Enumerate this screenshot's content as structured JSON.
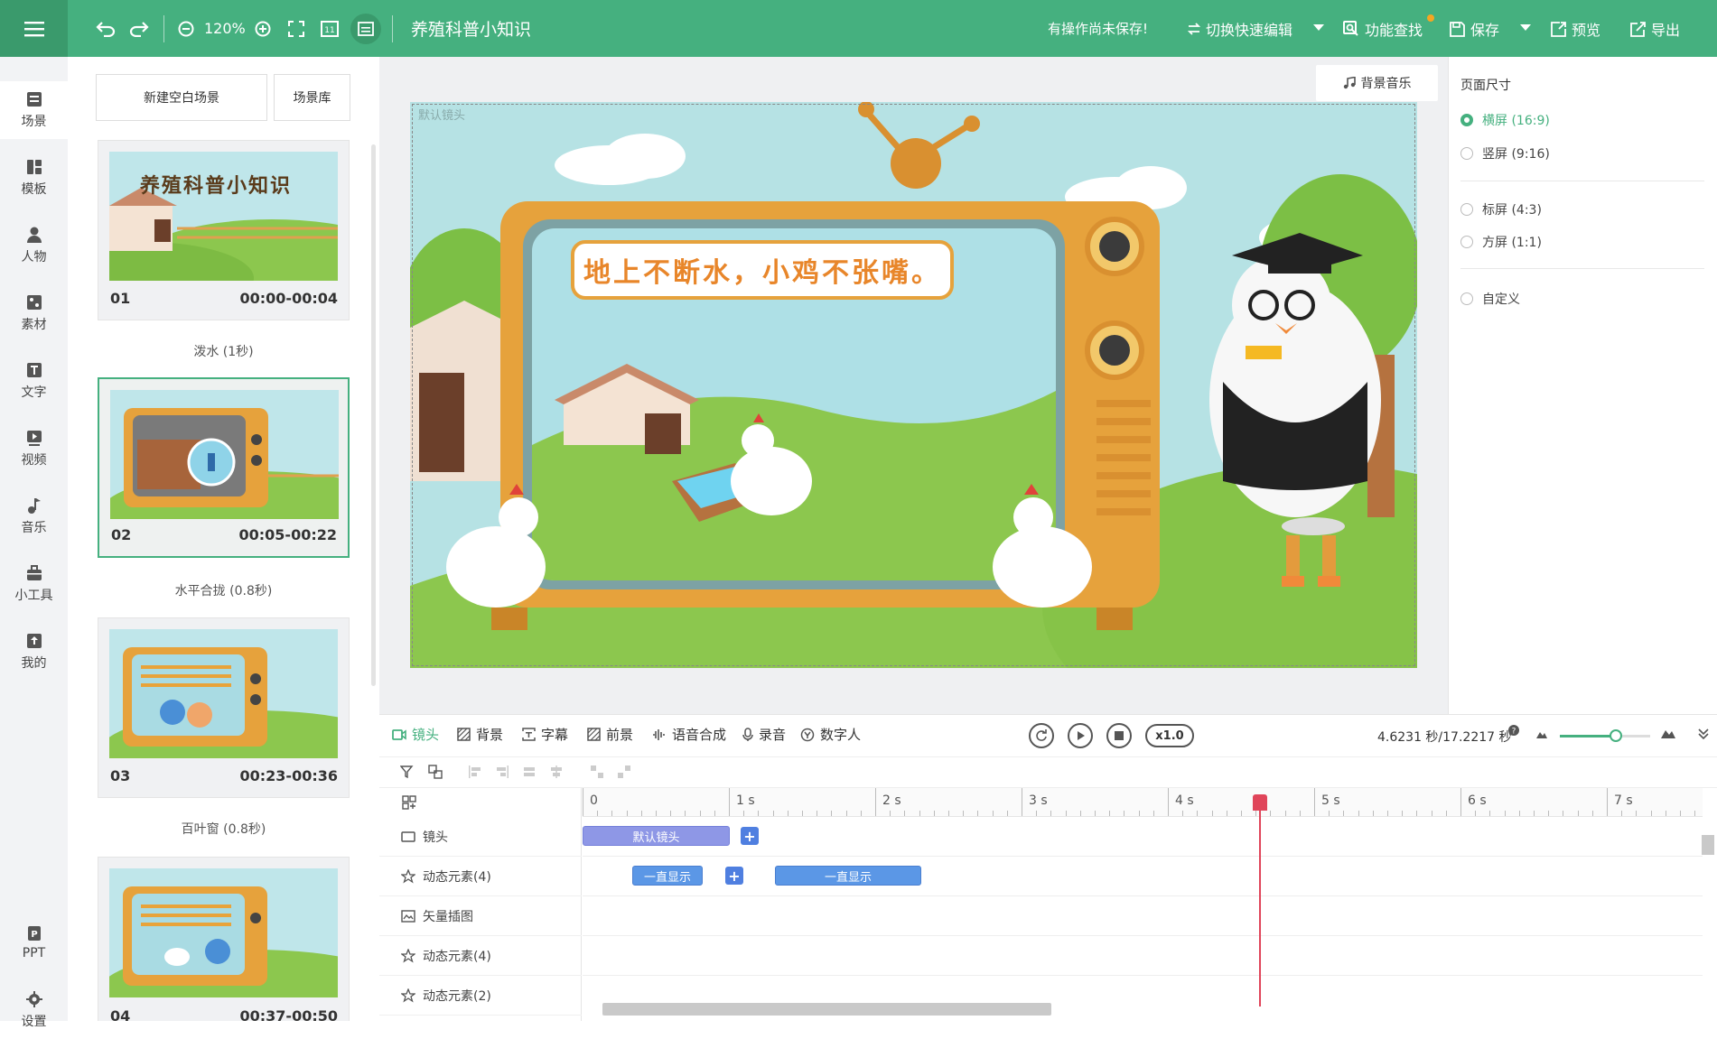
{
  "topbar": {
    "zoom": "120%",
    "project_title": "养殖科普小知识",
    "unsaved_notice": "有操作尚未保存!",
    "quick_edit": "切换快速编辑",
    "feature_search": "功能查找",
    "save": "保存",
    "preview": "预览",
    "export": "导出"
  },
  "nav": {
    "items": [
      {
        "label": "场景",
        "icon": "scene-icon"
      },
      {
        "label": "模板",
        "icon": "template-icon"
      },
      {
        "label": "人物",
        "icon": "person-icon"
      },
      {
        "label": "素材",
        "icon": "material-icon"
      },
      {
        "label": "文字",
        "icon": "text-icon"
      },
      {
        "label": "视频",
        "icon": "video-icon"
      },
      {
        "label": "音乐",
        "icon": "music-icon"
      },
      {
        "label": "小工具",
        "icon": "toolbox-icon"
      },
      {
        "label": "我的",
        "icon": "upload-icon"
      }
    ],
    "bottom": [
      {
        "label": "PPT",
        "icon": "ppt-icon"
      },
      {
        "label": "设置",
        "icon": "settings-icon"
      }
    ]
  },
  "scene_panel": {
    "new_blank": "新建空白场景",
    "library": "场景库",
    "scenes": [
      {
        "num": "01",
        "time": "00:00-00:04",
        "transition": "泼水 (1秒)",
        "thumb_title": "养殖科普小知识"
      },
      {
        "num": "02",
        "time": "00:05-00:22",
        "transition": "水平合拢 (0.8秒)"
      },
      {
        "num": "03",
        "time": "00:23-00:36",
        "transition": "百叶窗 (0.8秒)"
      },
      {
        "num": "04",
        "time": "00:37-00:50"
      }
    ]
  },
  "stage": {
    "camera_label": "默认镜头",
    "bgm_button": "背景音乐",
    "caption": "地上不断水，小鸡不张嘴。"
  },
  "page_size": {
    "title": "页面尺寸",
    "options": [
      {
        "label": "横屏 (16:9)",
        "selected": true
      },
      {
        "label": "竖屏 (9:16)",
        "selected": false
      },
      {
        "label": "标屏 (4:3)",
        "selected": false
      },
      {
        "label": "方屏 (1:1)",
        "selected": false
      },
      {
        "label": "自定义",
        "selected": false
      }
    ]
  },
  "timeline": {
    "tabs": [
      "镜头",
      "背景",
      "字幕",
      "前景",
      "语音合成",
      "录音",
      "数字人"
    ],
    "speed": "x1.0",
    "time_readout": "4.6231 秒/17.2217 秒",
    "zoom_level": 0.62,
    "ruler": [
      "0",
      "1 s",
      "2 s",
      "3 s",
      "4 s",
      "5 s",
      "6 s",
      "7 s"
    ],
    "tracks": [
      {
        "label": "镜头",
        "icon": "camera-icon"
      },
      {
        "label": "动态元素(4)",
        "icon": "star-icon"
      },
      {
        "label": "矢量插图",
        "icon": "vector-icon"
      },
      {
        "label": "动态元素(4)",
        "icon": "star-icon"
      },
      {
        "label": "动态元素(2)",
        "icon": "star-icon"
      }
    ],
    "clips": {
      "camera": "默认镜头",
      "always_show_1": "一直显示",
      "always_show_2": "一直显示"
    }
  },
  "colors": {
    "accent": "#45b07f",
    "playhead": "#e0455a",
    "clip_blue": "#5b97e6"
  }
}
